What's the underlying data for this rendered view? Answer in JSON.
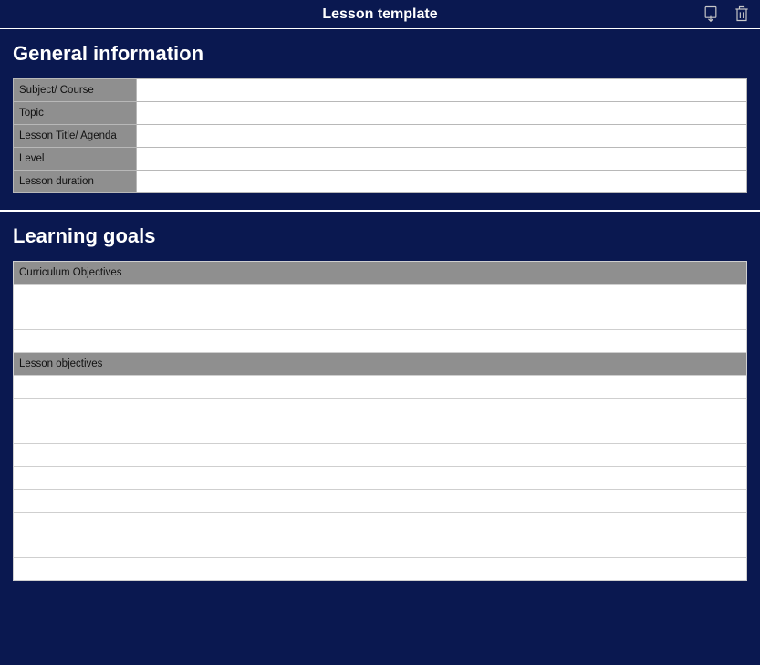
{
  "header": {
    "title": "Lesson template"
  },
  "sections": {
    "general": {
      "title": "General information",
      "rows": [
        {
          "label": "Subject/ Course",
          "value": ""
        },
        {
          "label": "Topic",
          "value": ""
        },
        {
          "label": "Lesson Title/ Agenda",
          "value": ""
        },
        {
          "label": "Level",
          "value": ""
        },
        {
          "label": "Lesson duration",
          "value": ""
        }
      ]
    },
    "goals": {
      "title": "Learning goals",
      "curriculum": {
        "header": "Curriculum Objectives",
        "rows": [
          "",
          "",
          ""
        ]
      },
      "lesson": {
        "header": "Lesson objectives",
        "rows": [
          "",
          "",
          "",
          "",
          "",
          "",
          "",
          "",
          ""
        ]
      }
    }
  }
}
